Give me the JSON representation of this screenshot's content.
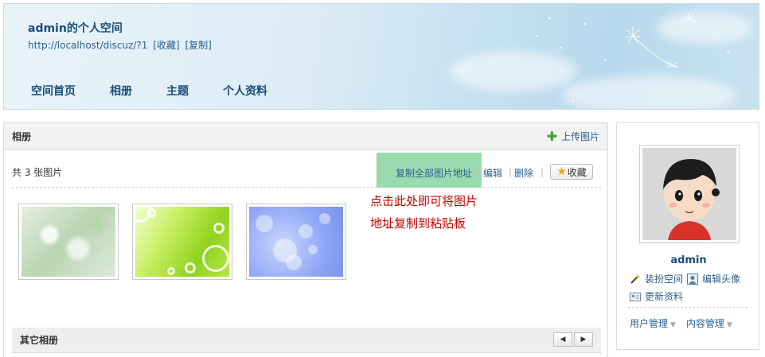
{
  "header": {
    "space_title": "admin的个人空间",
    "space_url": "http://localhost/discuz/?1",
    "bookmark_label": "[收藏]",
    "copy_label": "[复制]",
    "nav": [
      "空间首页",
      "相册",
      "主题",
      "个人资料"
    ]
  },
  "album": {
    "title": "相册",
    "upload_label": "上传图片",
    "photo_count": "共 3 张图片",
    "copy_all_label": "复制全部图片地址",
    "edit_label": "编辑",
    "delete_label": "删除",
    "favorite_label": "收藏",
    "annotation_line1": "点击此处即可将图片",
    "annotation_line2": "地址复制到粘贴板",
    "thumbnails": [
      "thumb-1",
      "thumb-2",
      "thumb-3"
    ],
    "other_albums_title": "其它相册",
    "pager_prev": "◀",
    "pager_next": "▶"
  },
  "sidebar": {
    "username": "admin",
    "decorate_label": "装扮空间",
    "edit_avatar_label": "编辑头像",
    "update_profile_label": "更新资料",
    "user_manage_label": "用户管理",
    "content_manage_label": "内容管理"
  },
  "colors": {
    "link": "#2a5f8f",
    "title": "#1a4e7a",
    "annotation": "#c40000",
    "highlight": "#8fd6a6"
  }
}
